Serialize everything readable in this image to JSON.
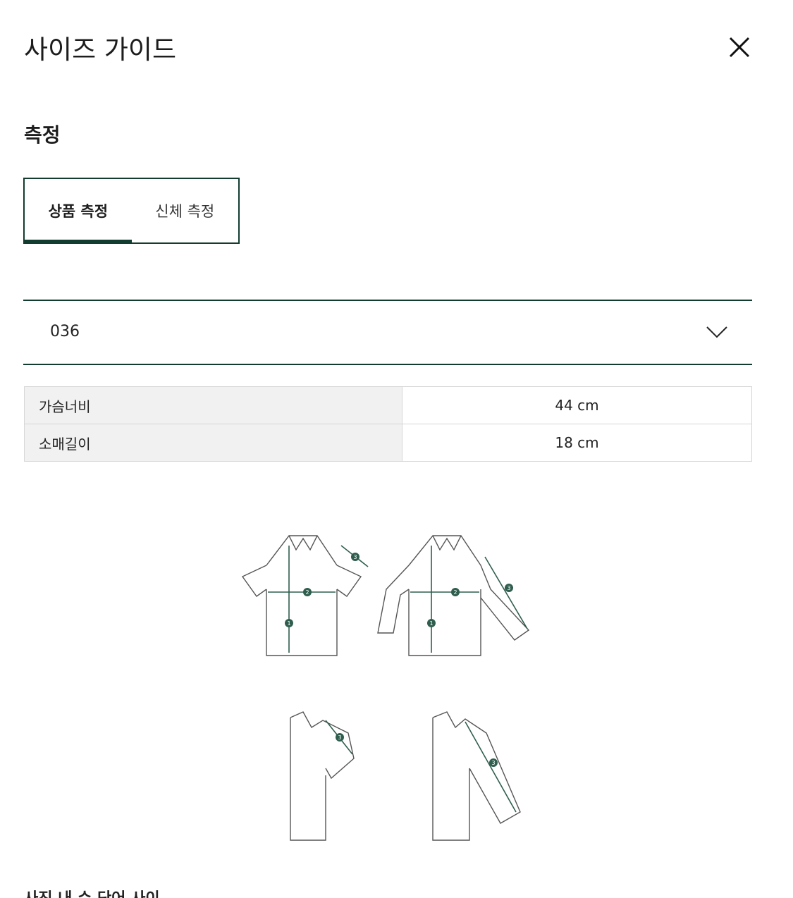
{
  "header": {
    "title": "사이즈 가이드",
    "close_icon": "close-icon"
  },
  "section": {
    "title": "측정"
  },
  "tabs": [
    {
      "label": "상품 측정",
      "active": true
    },
    {
      "label": "신체 측정",
      "active": false
    }
  ],
  "size_select": {
    "value": "036",
    "icon": "chevron-down-icon"
  },
  "measurements": [
    {
      "label": "가슴너비",
      "value": "44 cm"
    },
    {
      "label": "소매길이",
      "value": "18 cm"
    }
  ],
  "diagram": {
    "markers": [
      "1",
      "2",
      "3"
    ],
    "accent_color": "#2f5e4e"
  },
  "footer": {
    "partial_text": "사진 내 수 단어 사이"
  },
  "colors": {
    "accent": "#123c2f",
    "table_label_bg": "#f1f1f1",
    "border": "#d6d6d6"
  }
}
